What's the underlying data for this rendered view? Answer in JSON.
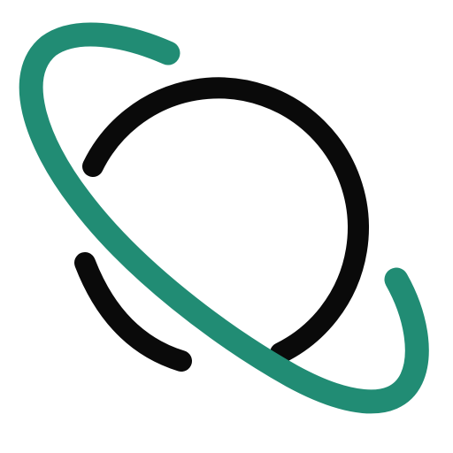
{
  "icon": {
    "name": "planet-icon",
    "colors": {
      "background": "#ffffff",
      "planet": "#0a0a0a",
      "ring": "#218c74"
    }
  }
}
